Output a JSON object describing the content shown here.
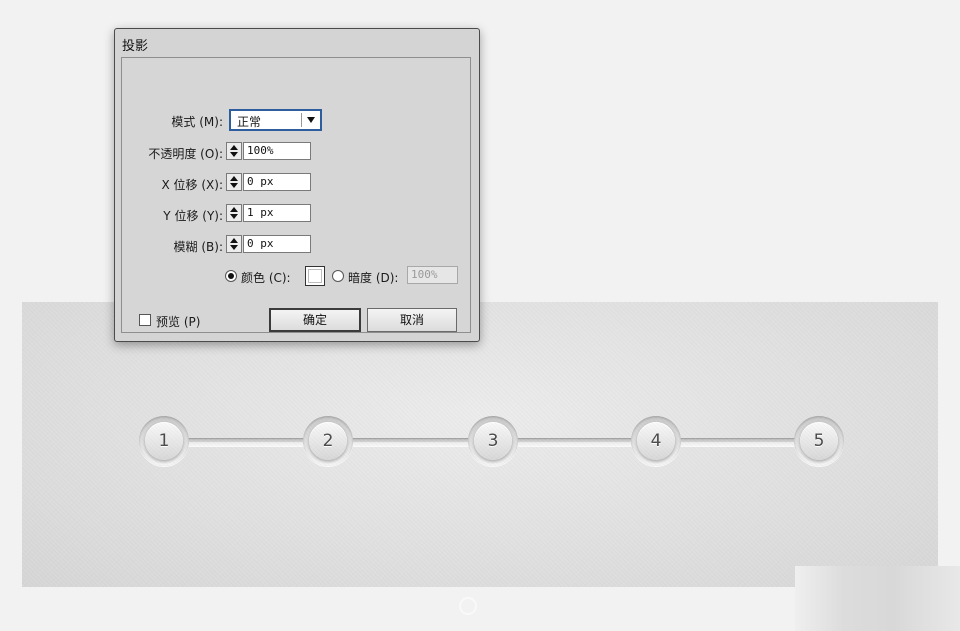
{
  "dialog": {
    "title": "投影",
    "mode": {
      "label": "模式 (M):",
      "value": "正常"
    },
    "opacity": {
      "label": "不透明度 (O):",
      "value": "100%"
    },
    "x_offset": {
      "label": "X 位移 (X):",
      "value": "0 px"
    },
    "y_offset": {
      "label": "Y 位移 (Y):",
      "value": "1 px"
    },
    "blur": {
      "label": "模糊 (B):",
      "value": "0 px"
    },
    "color_option": {
      "label": "颜色 (C):",
      "selected": true,
      "swatch": "#ffffff"
    },
    "darkness_option": {
      "label": "暗度 (D):",
      "selected": false,
      "value": "100%"
    },
    "preview": {
      "label": "预览 (P)",
      "checked": false
    },
    "ok_label": "确定",
    "cancel_label": "取消"
  },
  "stepper": {
    "steps": [
      "1",
      "2",
      "3",
      "4",
      "5"
    ]
  },
  "colors": {
    "dialog_bg": "#d4d4d4",
    "canvas_bg": "#e2e2e2",
    "select_focus_border": "#2e5d9e"
  }
}
